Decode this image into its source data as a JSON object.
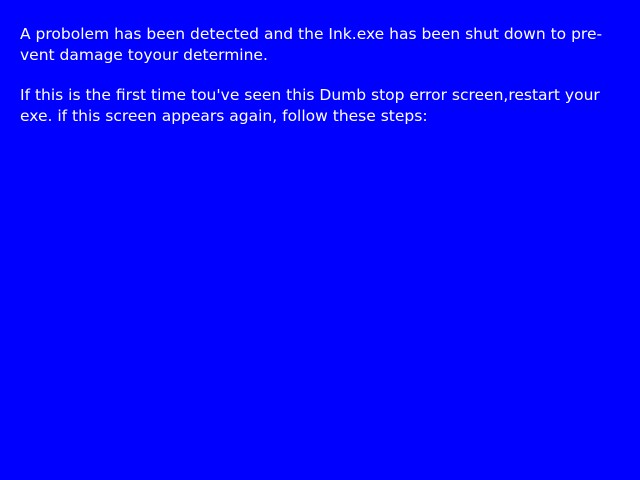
{
  "colors": {
    "background": "#0000FF",
    "text": "#FFFFFF"
  },
  "error_screen": {
    "paragraph_1": [
      "A probolem has been detected and the Ink.exe has been shut down to pre-",
      "vent damage toyour determine."
    ],
    "paragraph_2": [
      "If this is the first time tou've seen this Dumb stop error screen,restart your",
      "exe. if this screen appears again, follow these steps:"
    ]
  }
}
